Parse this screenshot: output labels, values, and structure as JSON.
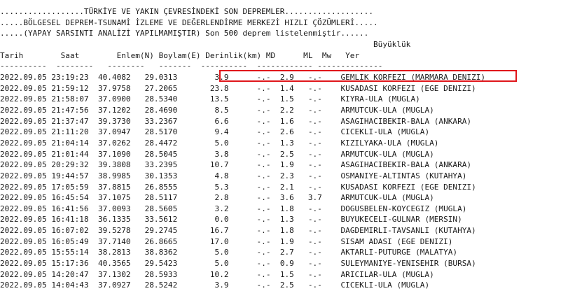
{
  "header": {
    "line1": "..................TÜRKİYE VE YAKIN ÇEVRESİNDEKİ SON DEPREMLER...................",
    "line2": ".....BÖLGESEL DEPREM-TSUNAMİ İZLEME VE DEĞERLENDİRME MERKEZİ HIZLI ÇÖZÜMLERİ.....",
    "line3": ".....(YAPAY SARSINTI ANALİZİ YAPILMAMIŞTIR) Son 500 deprem listelenmiştir......"
  },
  "columns": {
    "magnitude_group": "Büyüklük",
    "date": "Tarih",
    "time": "Saat",
    "latitude": "Enlem(N)",
    "longitude": "Boylam(E)",
    "depth": "Derinlik(km)",
    "md": "MD",
    "ml": "ML",
    "mw": "Mw",
    "location": "Yer"
  },
  "separators": [
    "----------",
    "--------",
    "--------",
    "-------",
    "----------",
    "------------",
    "--------------"
  ],
  "rows": [
    {
      "date": "2022.09.05",
      "time": "23:19:23",
      "lat": "40.4082",
      "lon": "29.0313",
      "depth": "3.9",
      "md": "-.-",
      "ml": "2.9",
      "mw": "-.-",
      "location": "GEMLIK KORFEZI (MARMARA DENIZI)"
    },
    {
      "date": "2022.09.05",
      "time": "21:59:12",
      "lat": "37.9758",
      "lon": "27.2065",
      "depth": "23.8",
      "md": "-.-",
      "ml": "1.4",
      "mw": "-.-",
      "location": "KUSADASI KORFEZI (EGE DENIZI)"
    },
    {
      "date": "2022.09.05",
      "time": "21:58:07",
      "lat": "37.0900",
      "lon": "28.5340",
      "depth": "13.5",
      "md": "-.-",
      "ml": "1.5",
      "mw": "-.-",
      "location": "KIYRA-ULA (MUGLA)"
    },
    {
      "date": "2022.09.05",
      "time": "21:47:56",
      "lat": "37.1202",
      "lon": "28.4690",
      "depth": "8.5",
      "md": "-.-",
      "ml": "2.2",
      "mw": "-.-",
      "location": "ARMUTCUK-ULA (MUGLA)"
    },
    {
      "date": "2022.09.05",
      "time": "21:37:47",
      "lat": "39.3730",
      "lon": "33.2367",
      "depth": "6.6",
      "md": "-.-",
      "ml": "1.6",
      "mw": "-.-",
      "location": "ASAGIHACIBEKIR-BALA (ANKARA)"
    },
    {
      "date": "2022.09.05",
      "time": "21:11:20",
      "lat": "37.0947",
      "lon": "28.5170",
      "depth": "9.4",
      "md": "-.-",
      "ml": "2.6",
      "mw": "-.-",
      "location": "CICEKLI-ULA (MUGLA)"
    },
    {
      "date": "2022.09.05",
      "time": "21:04:14",
      "lat": "37.0262",
      "lon": "28.4472",
      "depth": "5.0",
      "md": "-.-",
      "ml": "1.3",
      "mw": "-.-",
      "location": "KIZILYAKA-ULA (MUGLA)"
    },
    {
      "date": "2022.09.05",
      "time": "21:01:44",
      "lat": "37.1090",
      "lon": "28.5045",
      "depth": "3.8",
      "md": "-.-",
      "ml": "2.5",
      "mw": "-.-",
      "location": "ARMUTCUK-ULA (MUGLA)"
    },
    {
      "date": "2022.09.05",
      "time": "20:29:32",
      "lat": "39.3808",
      "lon": "33.2395",
      "depth": "10.7",
      "md": "-.-",
      "ml": "1.9",
      "mw": "-.-",
      "location": "ASAGIHACIBEKIR-BALA (ANKARA)"
    },
    {
      "date": "2022.09.05",
      "time": "19:44:57",
      "lat": "38.9985",
      "lon": "30.1353",
      "depth": "4.8",
      "md": "-.-",
      "ml": "2.3",
      "mw": "-.-",
      "location": "OSMANIYE-ALTINTAS (KUTAHYA)"
    },
    {
      "date": "2022.09.05",
      "time": "17:05:59",
      "lat": "37.8815",
      "lon": "26.8555",
      "depth": "5.3",
      "md": "-.-",
      "ml": "2.1",
      "mw": "-.-",
      "location": "KUSADASI KORFEZI (EGE DENIZI)"
    },
    {
      "date": "2022.09.05",
      "time": "16:45:54",
      "lat": "37.1075",
      "lon": "28.5117",
      "depth": "2.8",
      "md": "-.-",
      "ml": "3.6",
      "mw": "3.7",
      "location": "ARMUTCUK-ULA (MUGLA)"
    },
    {
      "date": "2022.09.05",
      "time": "16:41:56",
      "lat": "37.0093",
      "lon": "28.5605",
      "depth": "3.2",
      "md": "-.-",
      "ml": "1.8",
      "mw": "-.-",
      "location": "DOGUSBELEN-KOYCEGIZ (MUGLA)"
    },
    {
      "date": "2022.09.05",
      "time": "16:41:18",
      "lat": "36.1335",
      "lon": "33.5612",
      "depth": "0.0",
      "md": "-.-",
      "ml": "1.3",
      "mw": "-.-",
      "location": "BUYUKECELI-GULNAR (MERSIN)"
    },
    {
      "date": "2022.09.05",
      "time": "16:07:02",
      "lat": "39.5278",
      "lon": "29.2745",
      "depth": "16.7",
      "md": "-.-",
      "ml": "1.8",
      "mw": "-.-",
      "location": "DAGDEMIRLI-TAVSANLI (KUTAHYA)"
    },
    {
      "date": "2022.09.05",
      "time": "16:05:49",
      "lat": "37.7140",
      "lon": "26.8665",
      "depth": "17.0",
      "md": "-.-",
      "ml": "1.9",
      "mw": "-.-",
      "location": "SISAM ADASI (EGE DENIZI)"
    },
    {
      "date": "2022.09.05",
      "time": "15:55:14",
      "lat": "38.2813",
      "lon": "38.8362",
      "depth": "5.0",
      "md": "-.-",
      "ml": "2.7",
      "mw": "-.-",
      "location": "AKTARLI-PUTURGE (MALATYA)"
    },
    {
      "date": "2022.09.05",
      "time": "15:17:36",
      "lat": "40.3565",
      "lon": "29.5423",
      "depth": "5.0",
      "md": "-.-",
      "ml": "0.9",
      "mw": "-.-",
      "location": "SULEYMANIYE-YENISEHIR (BURSA)"
    },
    {
      "date": "2022.09.05",
      "time": "14:20:47",
      "lat": "37.1302",
      "lon": "28.5933",
      "depth": "10.2",
      "md": "-.-",
      "ml": "1.5",
      "mw": "-.-",
      "location": "ARICILAR-ULA (MUGLA)"
    },
    {
      "date": "2022.09.05",
      "time": "14:04:43",
      "lat": "37.0927",
      "lon": "28.5242",
      "depth": "3.9",
      "md": "-.-",
      "ml": "2.5",
      "mw": "-.-",
      "location": "CICEKLI-ULA (MUGLA)"
    }
  ],
  "highlight": {
    "row": 0,
    "color": "#e0161b"
  }
}
